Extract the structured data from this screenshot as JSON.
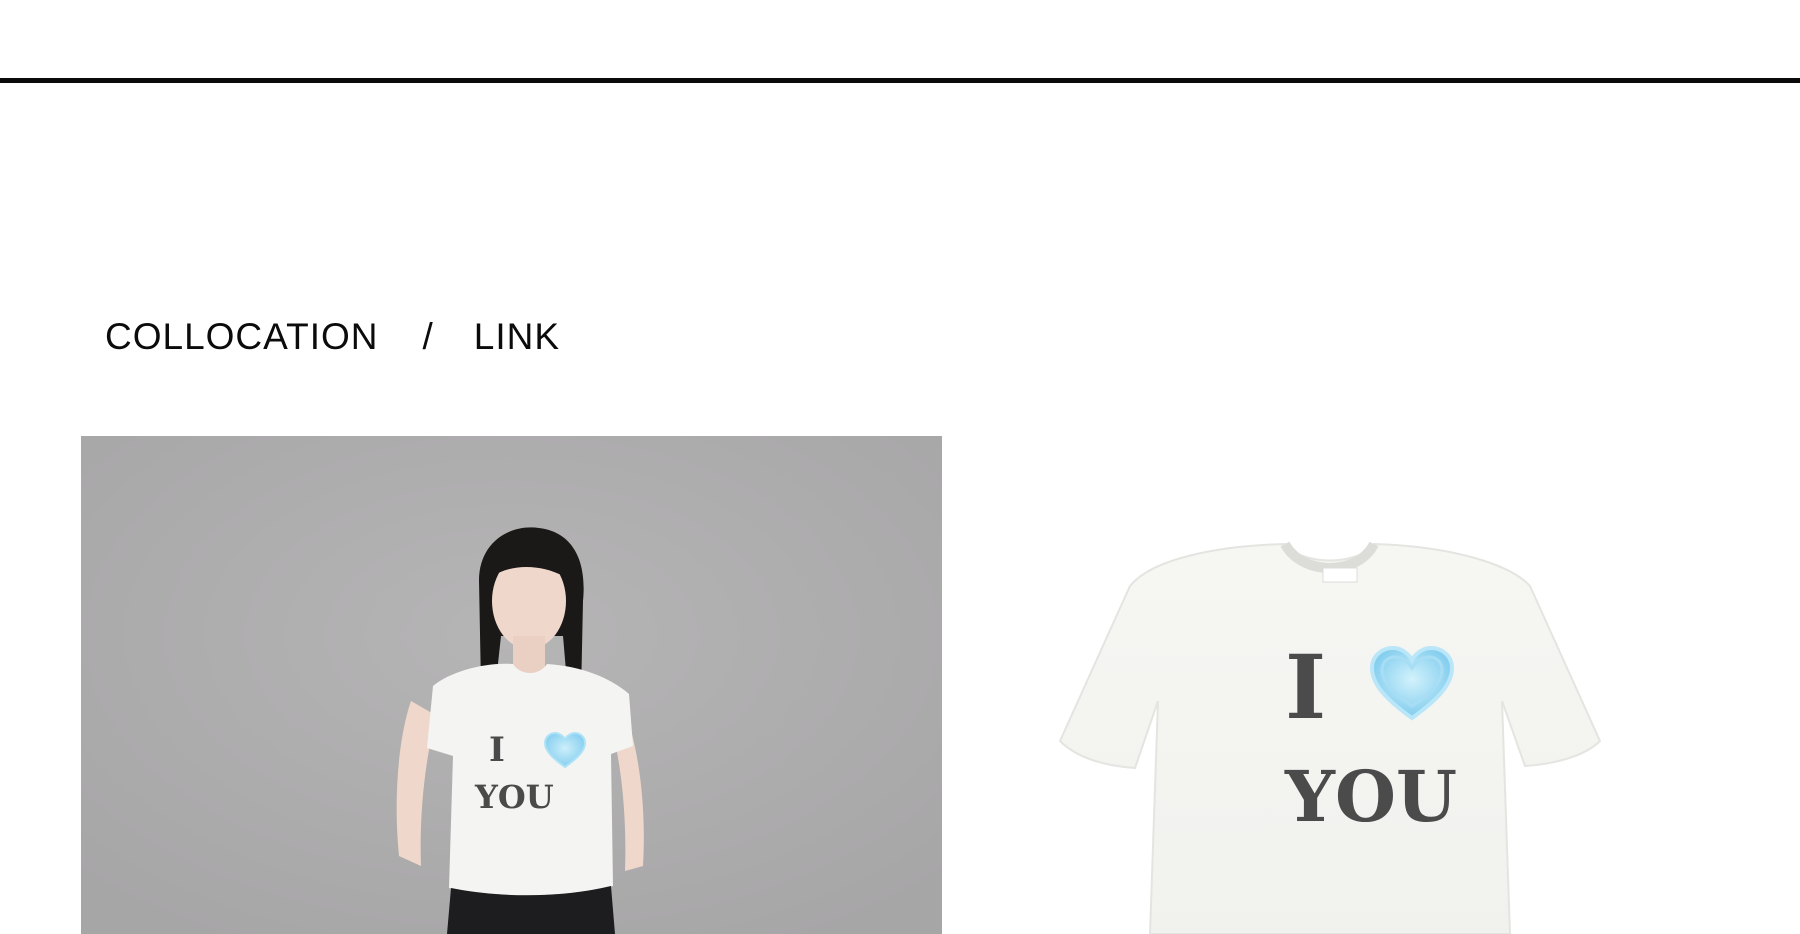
{
  "section": {
    "title_left": "COLLOCATION",
    "separator": "/",
    "title_right": "LINK"
  },
  "model_photo": {
    "shirt_print": {
      "line1": "I",
      "line2": "YOU"
    },
    "icon": "heart-icon",
    "background_color": "#aeaeae",
    "heart_color": "#8fd4f2"
  },
  "product_photo": {
    "shirt_print": {
      "line1": "I",
      "line2": "YOU"
    },
    "icon": "heart-icon",
    "heart_color": "#8fd4f2"
  }
}
